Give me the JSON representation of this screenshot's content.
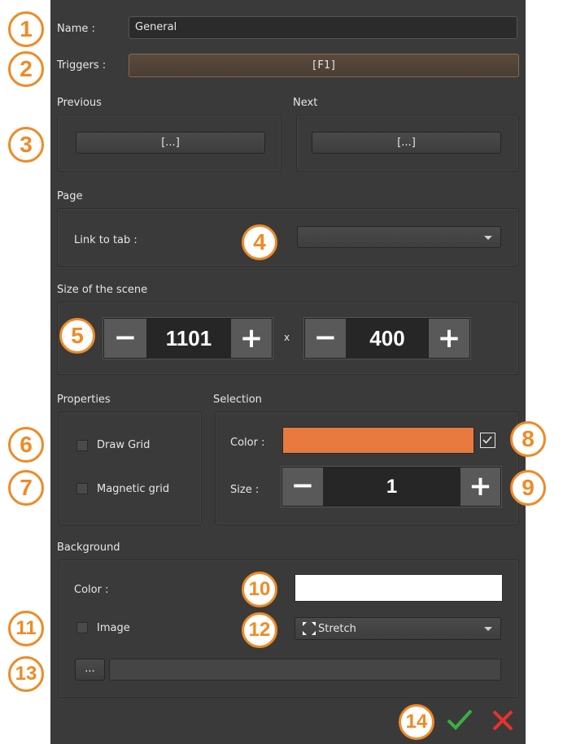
{
  "name": {
    "label": "Name :",
    "value": "General"
  },
  "triggers": {
    "label": "Triggers :",
    "button": "[F1]"
  },
  "previous": {
    "label": "Previous",
    "button": "[...]"
  },
  "next": {
    "label": "Next",
    "button": "[...]"
  },
  "page": {
    "label": "Page",
    "link_label": "Link to tab :",
    "link_value": ""
  },
  "scene": {
    "label": "Size of the scene",
    "width": "1101",
    "height": "400",
    "separator": "x",
    "minus": "−",
    "plus": "+"
  },
  "properties": {
    "label": "Properties",
    "draw_grid": "Draw Grid",
    "magnetic_grid": "Magnetic grid"
  },
  "selection": {
    "label": "Selection",
    "color_label": "Color :",
    "color": "#e8793f",
    "size_label": "Size :",
    "size": "1",
    "minus": "−",
    "plus": "+"
  },
  "background": {
    "label": "Background",
    "color_label": "Color :",
    "color": "#ffffff",
    "image_label": "Image",
    "mode": "Stretch",
    "browse": "...",
    "path": ""
  },
  "actions": {
    "ok_icon": "check-icon",
    "cancel_icon": "close-icon",
    "ok_color": "#3cb043",
    "cancel_color": "#e8322c"
  },
  "badges": [
    "1",
    "2",
    "3",
    "4",
    "5",
    "6",
    "7",
    "8",
    "9",
    "10",
    "11",
    "12",
    "13",
    "14"
  ],
  "accent": "#f08a24"
}
